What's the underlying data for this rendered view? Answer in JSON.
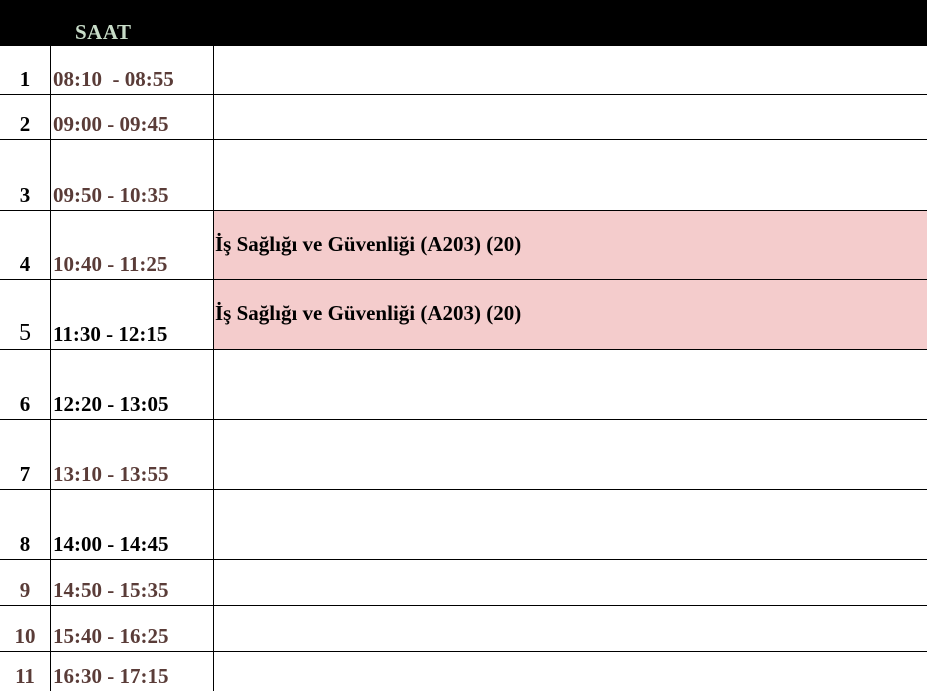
{
  "header": {
    "title": "SAAT"
  },
  "accent_color": "#f4cccc",
  "rows": [
    {
      "no": "1",
      "time": "08:10  - 08:55",
      "course": ""
    },
    {
      "no": "2",
      "time": "09:00 - 09:45",
      "course": ""
    },
    {
      "no": "3",
      "time": "09:50 - 10:35",
      "course": ""
    },
    {
      "no": "4",
      "time": "10:40 - 11:25",
      "course": "İş Sağlığı ve Güvenliği (A203) (20)"
    },
    {
      "no": "5",
      "time": "11:30 - 12:15",
      "course": "İş Sağlığı ve Güvenliği (A203) (20)"
    },
    {
      "no": "6",
      "time": "12:20 - 13:05",
      "course": ""
    },
    {
      "no": "7",
      "time": "13:10 - 13:55",
      "course": ""
    },
    {
      "no": "8",
      "time": "14:00 - 14:45",
      "course": ""
    },
    {
      "no": "9",
      "time": "14:50 - 15:35",
      "course": ""
    },
    {
      "no": "10",
      "time": "15:40 - 16:25",
      "course": ""
    },
    {
      "no": "11",
      "time": "16:30 - 17:15",
      "course": ""
    }
  ]
}
